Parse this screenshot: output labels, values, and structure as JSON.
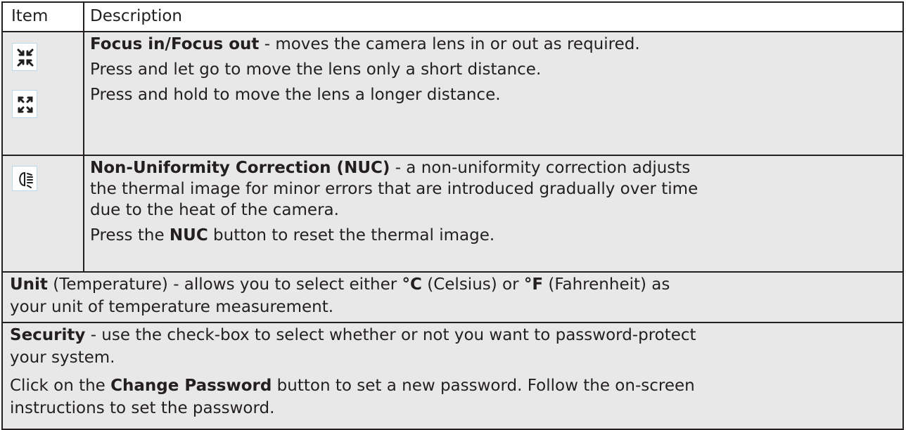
{
  "header": {
    "item": "Item",
    "description": "Description"
  },
  "focus": {
    "title": "Focus in/Focus out",
    "title_rest": " - moves the camera lens in or out as required.",
    "line2": "Press and let go to move the lens only a short distance.",
    "line3": "Press and hold to move the lens a longer distance.",
    "icons": [
      "focus-in-icon",
      "focus-out-icon"
    ]
  },
  "nuc": {
    "title": "Non-Uniformity Correction (NUC)",
    "title_rest": " - a non-uniformity correction adjusts",
    "line2": "the thermal image for minor errors that are introduced gradually over time",
    "line3": "due to the heat of the camera.",
    "press_pre": "Press the ",
    "press_bold": "NUC",
    "press_post": " button to reset the thermal image.",
    "icon": "nuc-icon"
  },
  "unit": {
    "title": "Unit",
    "t1": " (Temperature) - allows you to select either ",
    "c": "°C",
    "t2": " (Celsius) or ",
    "f": "°F",
    "t3": " (Fahrenheit) as",
    "line2": "your unit of temperature measurement."
  },
  "security": {
    "title": "Security",
    "t1": " - use the check-box to select whether or not you want to password-protect",
    "line2": "your system.",
    "click_pre": "Click on the ",
    "click_bold": "Change Password",
    "click_post": " button to set a new password. Follow the on-screen",
    "line4": "instructions to set the password."
  },
  "colors": {
    "border": "#231f20",
    "shade": "#e8e8e8",
    "icon_border": "#b9d8ec",
    "icon": "#1f1f1f"
  }
}
